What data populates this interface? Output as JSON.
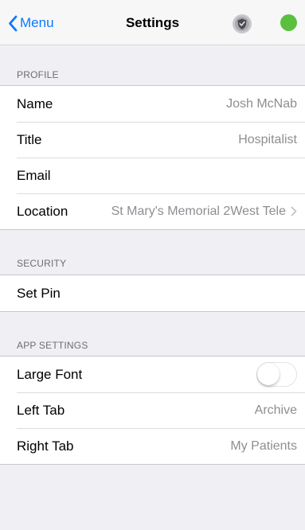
{
  "navbar": {
    "back_label": "Menu",
    "title": "Settings",
    "shield_icon": "shield-check-icon",
    "status_color": "#5ac03e",
    "accent_color": "#0a7aff"
  },
  "sections": {
    "profile": {
      "header": "PROFILE",
      "rows": {
        "name": {
          "label": "Name",
          "value": "Josh McNab"
        },
        "title": {
          "label": "Title",
          "value": "Hospitalist"
        },
        "email": {
          "label": "Email",
          "value": ""
        },
        "location": {
          "label": "Location",
          "value": "St Mary's Memorial 2West Tele"
        }
      }
    },
    "security": {
      "header": "SECURITY",
      "rows": {
        "set_pin": {
          "label": "Set Pin"
        }
      }
    },
    "app_settings": {
      "header": "APP SETTINGS",
      "rows": {
        "large_font": {
          "label": "Large Font",
          "enabled": false
        },
        "left_tab": {
          "label": "Left Tab",
          "value": "Archive"
        },
        "right_tab": {
          "label": "Right Tab",
          "value": "My Patients"
        }
      }
    }
  }
}
